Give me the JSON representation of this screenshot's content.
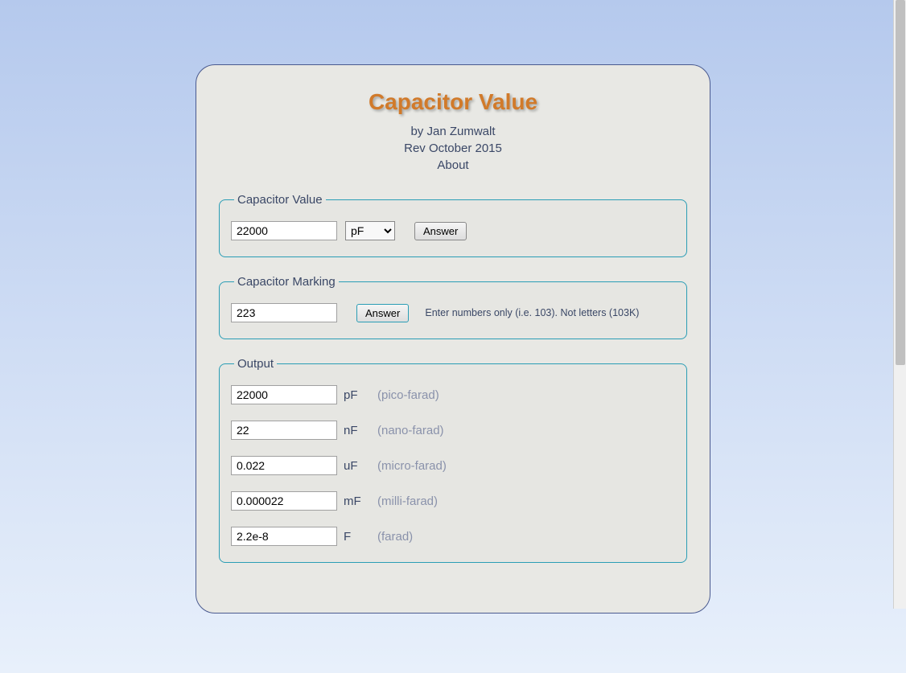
{
  "header": {
    "title": "Capacitor Value",
    "author": "by Jan Zumwalt",
    "revision": "Rev October 2015",
    "about": "About"
  },
  "capacitor_value": {
    "legend": "Capacitor Value",
    "value_input": "22000",
    "unit_selected": "pF",
    "answer_btn": "Answer"
  },
  "capacitor_marking": {
    "legend": "Capacitor Marking",
    "marking_input": "223",
    "answer_btn": "Answer",
    "hint": "Enter numbers only (i.e. 103). Not letters (103K)"
  },
  "output": {
    "legend": "Output",
    "rows": [
      {
        "value": "22000",
        "unit": "pF",
        "desc": "(pico-farad)"
      },
      {
        "value": "22",
        "unit": "nF",
        "desc": "(nano-farad)"
      },
      {
        "value": "0.022",
        "unit": "uF",
        "desc": "(micro-farad)"
      },
      {
        "value": "0.000022",
        "unit": "mF",
        "desc": "(milli-farad)"
      },
      {
        "value": "2.2e-8",
        "unit": "F",
        "desc": "(farad)"
      }
    ]
  }
}
